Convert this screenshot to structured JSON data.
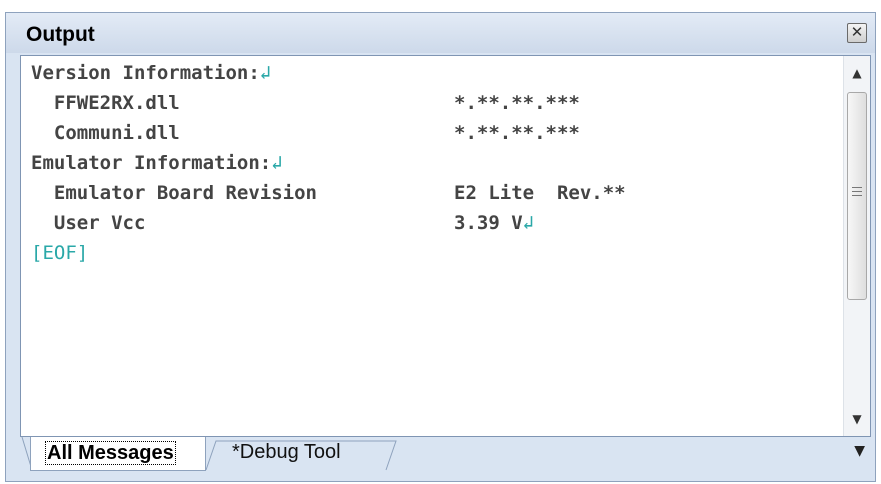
{
  "window": {
    "title": "Output"
  },
  "output": {
    "lines": [
      {
        "text": "Version Information:",
        "value": "",
        "ret": true,
        "ret_on_value": false
      },
      {
        "text": "  FFWE2RX.dll",
        "value": "*.**.**.***",
        "ret": false,
        "ret_on_value": false
      },
      {
        "text": "  Communi.dll",
        "value": "*.**.**.***",
        "ret": false,
        "ret_on_value": false
      },
      {
        "text": "Emulator Information:",
        "value": "",
        "ret": true,
        "ret_on_value": false
      },
      {
        "text": "  Emulator Board Revision",
        "value": "E2 Lite  Rev.**",
        "ret": false,
        "ret_on_value": false
      },
      {
        "text": "  User Vcc",
        "value": "3.39 V",
        "ret": false,
        "ret_on_value": true
      }
    ],
    "eof": "[EOF]",
    "return_glyph": "↲"
  },
  "tabs": [
    {
      "label": "All Messages",
      "active": true
    },
    {
      "label": "*Debug Tool",
      "active": false
    }
  ],
  "icons": {
    "close": "close-icon",
    "scroll_up": "scroll-up-icon",
    "scroll_down": "scroll-down-icon",
    "tab_overflow": "chevron-down-icon"
  },
  "colors": {
    "panel_bg": "#d9e4f2",
    "return_mark": "#2aa8a8",
    "eof_text": "#2aa8a8"
  }
}
